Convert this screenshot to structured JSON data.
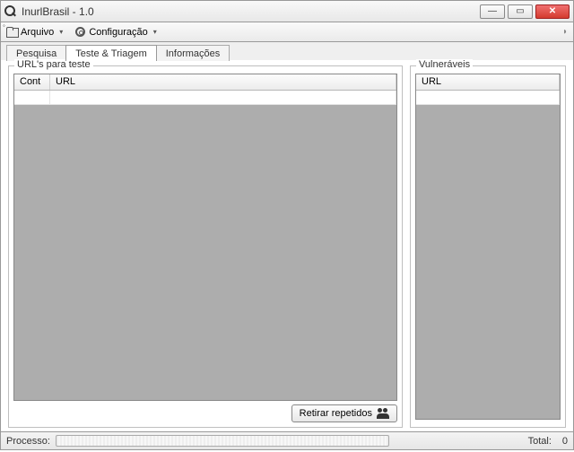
{
  "window": {
    "title": "InurlBrasil - 1.0"
  },
  "toolbar": {
    "arquivo_label": "Arquivo",
    "config_label": "Configuração"
  },
  "tabs": {
    "pesquisa": "Pesquisa",
    "teste_triagem": "Teste & Triagem",
    "informacoes": "Informações",
    "active_index": 1
  },
  "group_left": {
    "title": "URL's para teste",
    "columns": {
      "cont": "Cont",
      "url": "URL"
    },
    "rows": [],
    "button_label": "Retirar repetidos"
  },
  "group_right": {
    "title": "Vulneráveis",
    "columns": {
      "url": "URL"
    },
    "rows": []
  },
  "status": {
    "processo_label": "Processo:",
    "total_label": "Total:",
    "total_value": "0",
    "progress_percent": 0
  }
}
